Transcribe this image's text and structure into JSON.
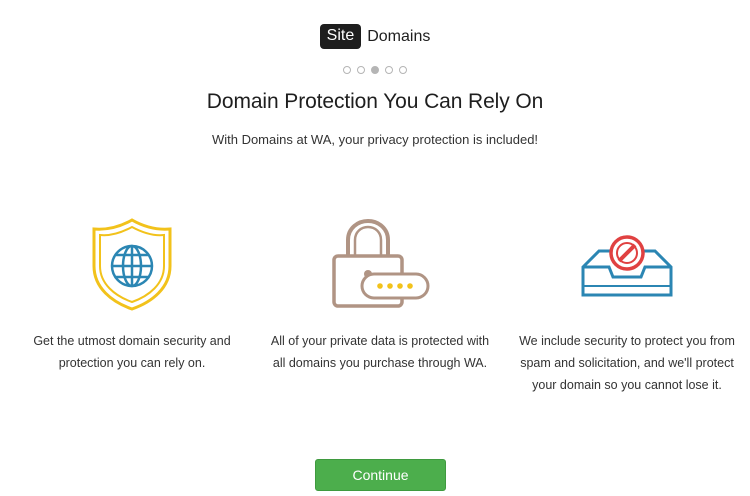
{
  "brand": {
    "badge": "Site",
    "name": "Domains"
  },
  "pager": {
    "total": 5,
    "active": 3
  },
  "headline": "Domain Protection You Can Rely On",
  "subhead": "With Domains at WA, your privacy protection is included!",
  "features": [
    {
      "icon": "shield-globe-icon",
      "text": "Get the utmost domain security and protection you can rely on."
    },
    {
      "icon": "padlock-password-icon",
      "text": "All of your private data is protected with all domains you purchase through WA."
    },
    {
      "icon": "inbox-blocked-icon",
      "text": "We include security to protect you from spam and solicitation, and we'll protect your domain so you cannot lose it."
    }
  ],
  "colors": {
    "shield": "#f2c21b",
    "globe": "#2b86b3",
    "lock": "#b09484",
    "inbox": "#2b86b3",
    "block": "#e04141",
    "button": "#4cae4c"
  },
  "actions": {
    "continue_label": "Continue"
  }
}
